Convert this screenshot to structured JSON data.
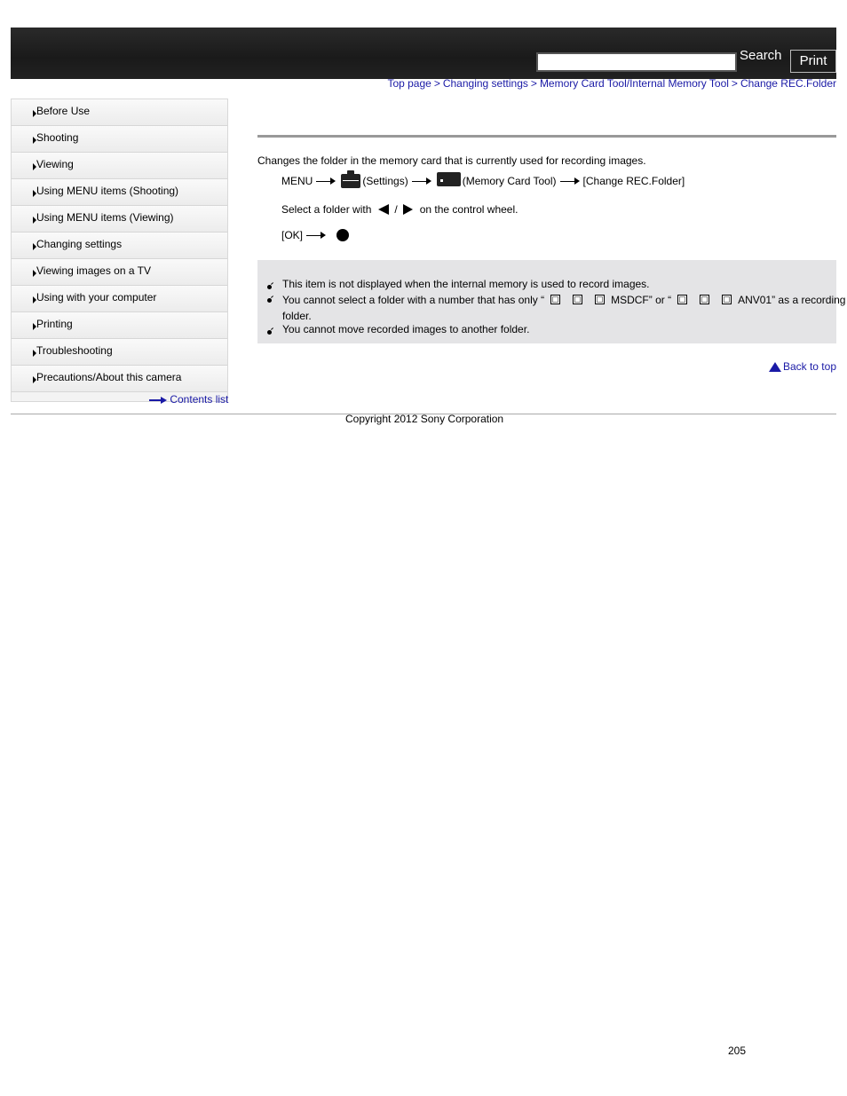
{
  "header": {
    "search_label": "Search",
    "print_label": "Print",
    "search_value": ""
  },
  "breadcrumb": [
    {
      "label": "Top page"
    },
    {
      "label": "Changing settings"
    },
    {
      "label": "Memory Card Tool/Internal Memory Tool"
    },
    {
      "label": "Change REC.Folder"
    }
  ],
  "breadcrumb_sep": ">",
  "sidebar": {
    "items": [
      {
        "label": "Before Use"
      },
      {
        "label": "Shooting"
      },
      {
        "label": "Viewing"
      },
      {
        "label": "Using MENU items (Shooting)"
      },
      {
        "label": "Using MENU items (Viewing)"
      },
      {
        "label": "Changing settings"
      },
      {
        "label": "Viewing images on a TV"
      },
      {
        "label": "Using with your computer"
      },
      {
        "label": "Printing"
      },
      {
        "label": "Troubleshooting"
      },
      {
        "label": "Precautions/About this camera"
      }
    ],
    "contents_link": "Contents list"
  },
  "main": {
    "intro": "Changes the folder in the memory card that is currently used for recording images.",
    "step1": {
      "menu": "MENU",
      "settings": "(Settings)",
      "card_tool": "(Memory Card Tool)",
      "target": "[Change REC.Folder]"
    },
    "step2": {
      "prefix": "Select a folder with",
      "slash": "/",
      "suffix": "on the control wheel."
    },
    "step3": {
      "ok": "[OK]"
    },
    "notes": {
      "n1": "This item is not displayed when the internal memory is used to record images.",
      "n2a": "You cannot select a folder with a number that has only “",
      "n2b": "MSDCF” or “",
      "n2c": "ANV01” as a recording",
      "n2d": "folder.",
      "n3": "You cannot move recorded images to another folder."
    },
    "back_to_top": "Back to top"
  },
  "footer": {
    "copyright": "Copyright 2012 Sony Corporation",
    "page_number": "205"
  }
}
